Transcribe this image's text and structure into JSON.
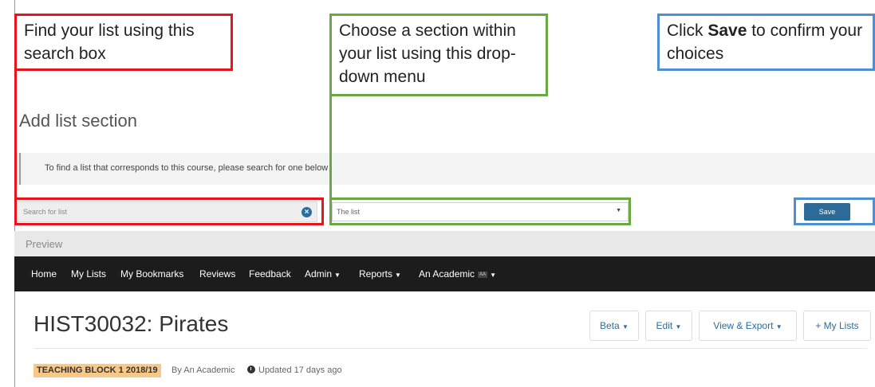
{
  "callouts": {
    "search": "Find your list using this search box",
    "section": "Choose a section within your list using this drop-down menu",
    "save_prefix": "Click ",
    "save_bold": "Save",
    "save_suffix": " to confirm your choices"
  },
  "form": {
    "title": "Add list section",
    "info": "To find a list that corresponds to this course, please search for one below",
    "search_placeholder": "Search for list",
    "section_value": "The list",
    "save_label": "Save"
  },
  "preview": {
    "label": "Preview",
    "nav": [
      "Home",
      "My Lists",
      "My Bookmarks",
      "Reviews",
      "Feedback",
      "Admin",
      "Reports",
      "An Academic"
    ],
    "user_badge": "AA",
    "list_title": "HIST30032: Pirates",
    "buttons": {
      "beta": "Beta",
      "edit": "Edit",
      "view_export": "View & Export",
      "my_lists": "+ My Lists"
    },
    "period_badge": "TEACHING BLOCK 1 2018/19",
    "by": "By An Academic",
    "updated": "Updated 17 days ago"
  },
  "colors": {
    "red": "#e8141b",
    "green": "#6aa843",
    "blue": "#4f8ed1",
    "save_button": "#2c6a98",
    "navbar": "#1c1c1c",
    "period_badge": "#f7c888"
  }
}
